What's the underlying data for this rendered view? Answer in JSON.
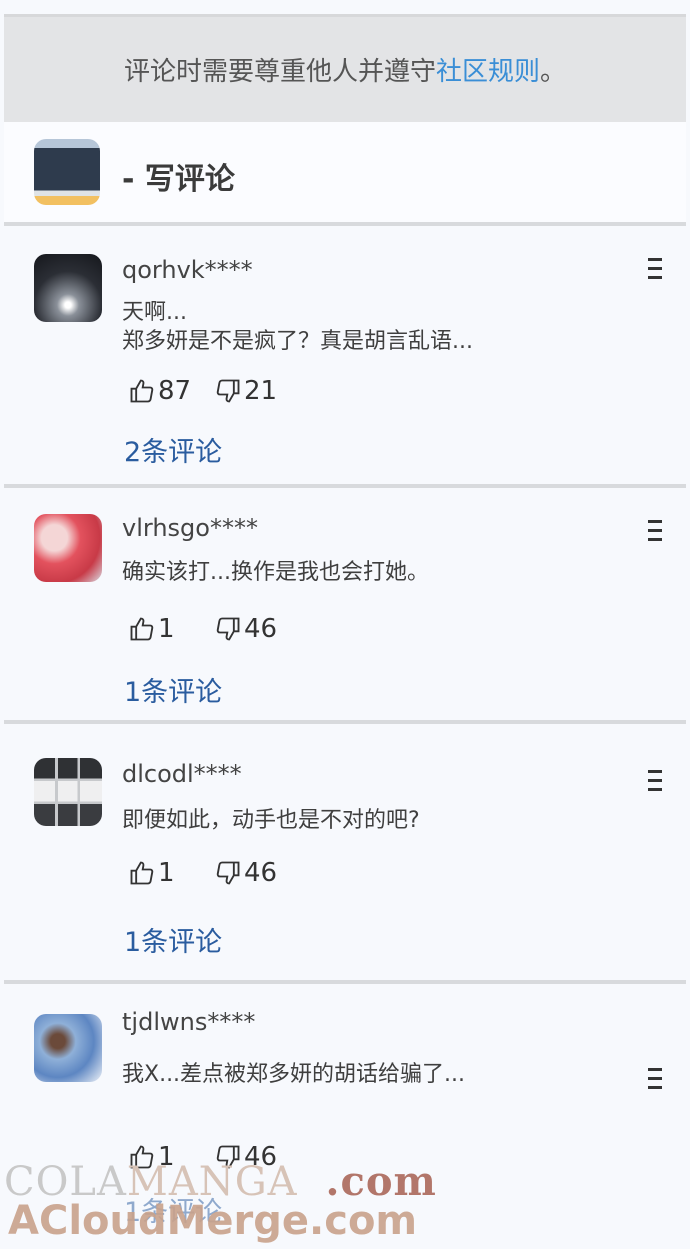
{
  "notice": {
    "text_before": "评论时需要尊重他人并遵守",
    "link": "社区规则",
    "text_after": "。"
  },
  "write": {
    "label": "- 写评论",
    "icon": "book-cover-icon"
  },
  "comments": [
    {
      "username": "qorhvk****",
      "lines": "天啊...\n郑多妍是不是疯了？真是胡言乱语...",
      "likes": "87",
      "dislikes": "21",
      "replies": "2条评论"
    },
    {
      "username": "vlrhsgo****",
      "lines": "确实该打...换作是我也会打她。",
      "likes": "1",
      "dislikes": "46",
      "replies": "1条评论"
    },
    {
      "username": "dlcodl****",
      "lines": "即便如此，动手也是不对的吧?",
      "likes": "1",
      "dislikes": "46",
      "replies": "1条评论"
    },
    {
      "username": "tjdlwns****",
      "lines": "我X...差点被郑多妍的胡话给骗了...",
      "likes": "1",
      "dislikes": "46",
      "replies": "1条评论"
    }
  ],
  "watermark": {
    "line1_a": "COLA",
    "line1_b": "MANGA",
    "line1_c": ".com",
    "line2": "ACloudMerge.com"
  },
  "colors": {
    "link": "#3a8ed6",
    "replies": "#2a5c9f",
    "background": "#f7f9fd"
  }
}
